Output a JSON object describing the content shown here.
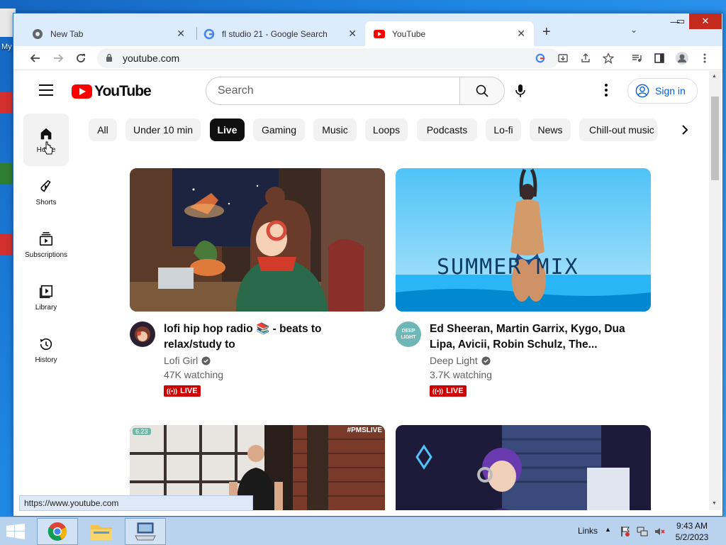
{
  "desktop": {
    "icon_label": "My"
  },
  "browser": {
    "tabs": [
      {
        "title": "New Tab",
        "icon": "chrome-icon"
      },
      {
        "title": "fl studio 21 - Google Search",
        "icon": "google-icon"
      },
      {
        "title": "YouTube",
        "icon": "youtube-icon",
        "active": true
      }
    ],
    "url": "youtube.com",
    "status_url": "https://www.youtube.com"
  },
  "youtube": {
    "logo_text": "YouTube",
    "search_placeholder": "Search",
    "sign_in": "Sign in",
    "sidebar": [
      {
        "label": "Home",
        "icon": "home-icon",
        "active": true
      },
      {
        "label": "Shorts",
        "icon": "shorts-icon"
      },
      {
        "label": "Subscriptions",
        "icon": "subscriptions-icon"
      },
      {
        "label": "Library",
        "icon": "library-icon"
      },
      {
        "label": "History",
        "icon": "history-icon"
      }
    ],
    "chips": [
      {
        "label": "All"
      },
      {
        "label": "Under 10 min"
      },
      {
        "label": "Live",
        "active": true
      },
      {
        "label": "Gaming"
      },
      {
        "label": "Music"
      },
      {
        "label": "Loops"
      },
      {
        "label": "Podcasts"
      },
      {
        "label": "Lo-fi"
      },
      {
        "label": "News"
      },
      {
        "label": "Chill-out music"
      }
    ],
    "videos": [
      {
        "title_line1": "lofi hip hop radio 📚 - beats to",
        "title_line2": "relax/study to",
        "channel": "Lofi Girl",
        "viewers": "47K watching",
        "badge": "LIVE"
      },
      {
        "title_line1": "Ed Sheeran, Martin Garrix, Kygo, Dua",
        "title_line2": "Lipa, Avicii, Robin Schulz, The...",
        "channel": "Deep Light",
        "viewers": "3.7K watching",
        "badge": "LIVE",
        "thumb_text": "SUMMER MIX",
        "avatar_text": "DEEP LIGHT"
      },
      {
        "thumb_corner_text": "#PMSLIVE",
        "thumb_timer": "6.23"
      },
      {}
    ],
    "colors": {
      "brand_red": "#ff0000",
      "live_red": "#cc0000",
      "link_blue": "#065fd4"
    }
  },
  "taskbar": {
    "links_label": "Links",
    "time": "9:43 AM",
    "date": "5/2/2023"
  }
}
